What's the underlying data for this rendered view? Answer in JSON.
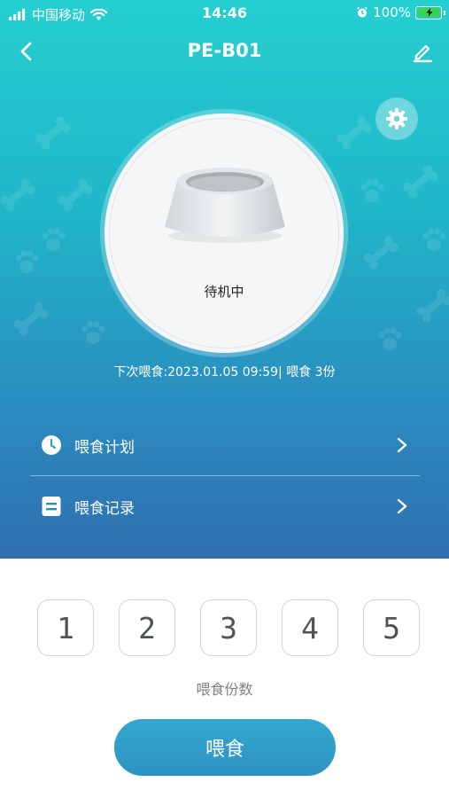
{
  "status_bar": {
    "carrier": "中国移动",
    "time": "14:46",
    "battery_percent": "100%",
    "battery_level": 1.0
  },
  "nav": {
    "title": "PE-B01"
  },
  "device": {
    "status": "待机中"
  },
  "next_feed": {
    "text": "下次喂食:2023.01.05 09:59| 喂食 3份"
  },
  "menu": [
    {
      "label": "喂食计划",
      "icon": "clock-icon"
    },
    {
      "label": "喂食记录",
      "icon": "record-icon"
    }
  ],
  "portions": {
    "options": [
      "1",
      "2",
      "3",
      "4",
      "5"
    ],
    "label": "喂食份数"
  },
  "feed_button": {
    "label": "喂食"
  },
  "colors": {
    "gradient_top": "#25cfd0",
    "gradient_bottom": "#2f6fb1",
    "button": "#2d9dc9",
    "battery": "#39d353"
  }
}
